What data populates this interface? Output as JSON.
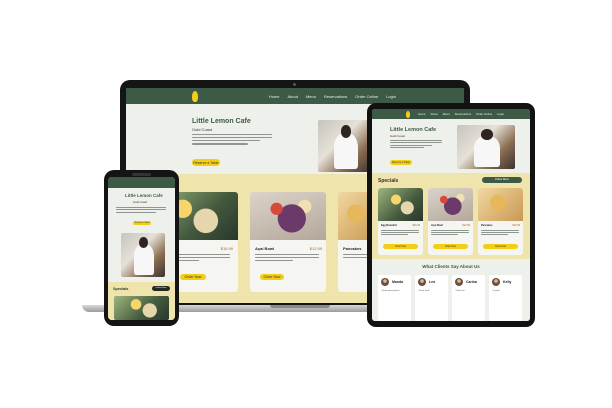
{
  "brand": {
    "name": "Little Lemon Cafe",
    "tagline": "Gold Coast",
    "accent": "#f4ce14",
    "primary": "#3d5a47",
    "band": "#f0e4ad"
  },
  "nav": {
    "items": [
      "Home",
      "About",
      "Menu",
      "Reservations",
      "Order Online",
      "Login"
    ],
    "tablet_items": [
      "Home",
      "About",
      "Menu",
      "Reservations",
      "Order Online",
      "Login"
    ]
  },
  "hero": {
    "title": "Little Lemon Cafe",
    "subtitle": "Gold Coast",
    "cta": "Reserve a Table"
  },
  "specials": {
    "title": "Specials",
    "menu_button": "Online Menu",
    "order_label": "Order Now",
    "items": [
      {
        "name": "Egg Benedict",
        "price": "$16.99"
      },
      {
        "name": "Açai Bowl",
        "price": "$12.99"
      },
      {
        "name": "Pancakes",
        "price": "$15.99"
      }
    ],
    "laptop_items": [
      {
        "name": "",
        "price": "$16.99"
      },
      {
        "name": "Açai Bowl",
        "price": "$12.99"
      },
      {
        "name": "Pancakes",
        "price": ""
      }
    ]
  },
  "testimonials": {
    "title": "What Clients Say About Us",
    "clients": [
      {
        "name": "Manda",
        "quote": "\"Great atmosphere\""
      },
      {
        "name": "Leo",
        "quote": "\"Great food\""
      },
      {
        "name": "Carina",
        "quote": "\"Delicious\""
      },
      {
        "name": "Kelly",
        "quote": "\"Lovely!\""
      }
    ]
  },
  "icons": {
    "logo": "lemon-logo-icon"
  }
}
